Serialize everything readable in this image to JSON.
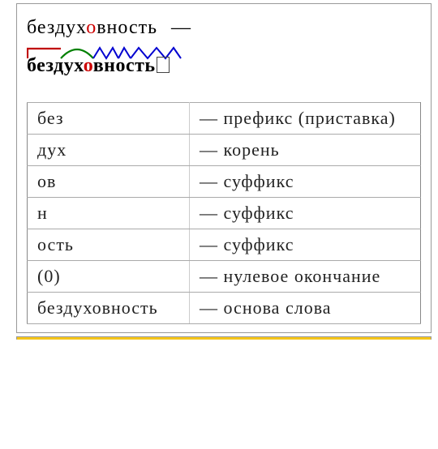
{
  "headword": {
    "pre": "бездух",
    "stress": "о",
    "post": "вность",
    "dash": "—"
  },
  "diagram": {
    "pre": "бездух",
    "stress": "о",
    "post": "вность"
  },
  "table": {
    "rows": [
      {
        "morph": "без",
        "desc": "— префикс (приставка)"
      },
      {
        "morph": "дух",
        "desc": "— корень"
      },
      {
        "morph": "ов",
        "desc": "— суффикс"
      },
      {
        "morph": "н",
        "desc": "— суффикс"
      },
      {
        "morph": "ость",
        "desc": "— суффикс"
      },
      {
        "morph": "(0)",
        "desc": "— нулевое окончание"
      },
      {
        "morph": "бездуховность",
        "desc": "— основа слова"
      }
    ]
  },
  "colors": {
    "prefix": "#c00000",
    "root": "#008000",
    "suffix": "#0000d0"
  }
}
